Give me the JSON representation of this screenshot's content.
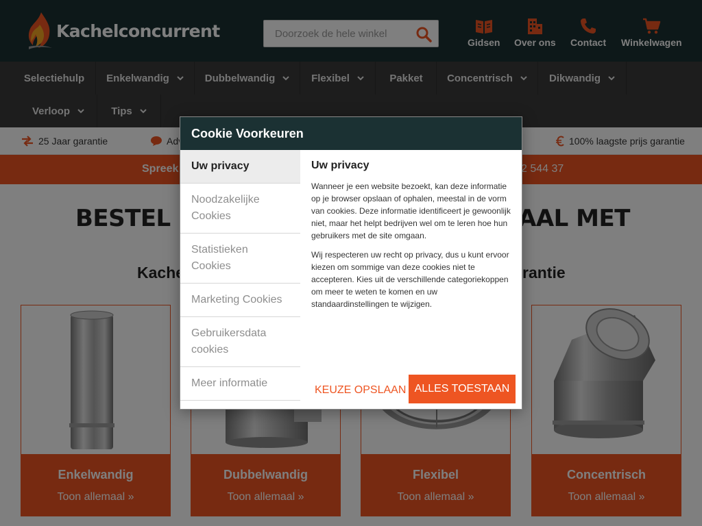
{
  "header": {
    "logo_text": "Kachelconcurrent",
    "search_placeholder": "Doorzoek de hele winkel",
    "nav": [
      {
        "label": "Gidsen",
        "icon": "book-icon"
      },
      {
        "label": "Over ons",
        "icon": "building-icon"
      },
      {
        "label": "Contact",
        "icon": "phone-icon"
      },
      {
        "label": "Winkelwagen",
        "icon": "cart-icon"
      }
    ]
  },
  "categories": [
    {
      "label": "Selectiehulp"
    },
    {
      "label": "Enkelwandig"
    },
    {
      "label": "Dubbelwandig"
    },
    {
      "label": "Flexibel"
    },
    {
      "label": "Pakket"
    },
    {
      "label": "Concentrisch"
    },
    {
      "label": "Dikwandig"
    },
    {
      "label": "Verloop"
    },
    {
      "label": "Tips"
    }
  ],
  "usps": [
    {
      "label": "25 Jaar garantie",
      "icon": "swap-arrows-icon"
    },
    {
      "label": "Adv",
      "icon": "chat-icon"
    },
    {
      "label": "100% laagste prijs garantie",
      "icon": "euro-icon"
    }
  ],
  "banner": {
    "left_text": "Spreek",
    "right_text": "2 544 37"
  },
  "main": {
    "headline_left": "BESTEL U",
    "headline_right": "AAL MET",
    "subline_left": "Kache",
    "subline_right": "rantie"
  },
  "products": [
    {
      "title": "Enkelwandig",
      "link": "Toon allemaal »",
      "icon": "single-wall-pipe-icon"
    },
    {
      "title": "Dubbelwandig",
      "link": "Toon allemaal »",
      "icon": "double-wall-tee-icon"
    },
    {
      "title": "Flexibel",
      "link": "Toon allemaal »",
      "icon": "flexible-pipe-icon"
    },
    {
      "title": "Concentrisch",
      "link": "Toon allemaal »",
      "icon": "concentric-bend-icon"
    }
  ],
  "cookie_modal": {
    "title": "Cookie Voorkeuren",
    "tabs": [
      {
        "label": "Uw privacy",
        "active": true
      },
      {
        "label": "Noodzakelijke Cookies",
        "active": false
      },
      {
        "label": "Statistieken Cookies",
        "active": false
      },
      {
        "label": "Marketing Cookies",
        "active": false
      },
      {
        "label": "Gebruikersdata cookies",
        "active": false
      },
      {
        "label": "Meer informatie",
        "active": false
      }
    ],
    "content_title": "Uw privacy",
    "paragraphs": [
      "Wanneer je een website bezoekt, kan deze informatie op je browser opslaan of ophalen, meestal in de vorm van cookies. Deze informatie identificeert je gewoonlijk niet, maar het helpt bedrijven wel om te leren hoe hun gebruikers met de site omgaan.",
      "Wij respecteren uw recht op privacy, dus u kunt ervoor kiezen om sommige van deze cookies niet te accepteren. Kies uit de verschillende categoriekoppen om meer te weten te komen en uw standaardinstellingen te wijzigen."
    ],
    "save_label": "KEUZE OPSLAAN",
    "allow_label": "ALLES TOESTAAN"
  },
  "colors": {
    "header_bg": "#1b3133",
    "nav_bg": "#3b3b3b",
    "accent": "#ee5522"
  }
}
